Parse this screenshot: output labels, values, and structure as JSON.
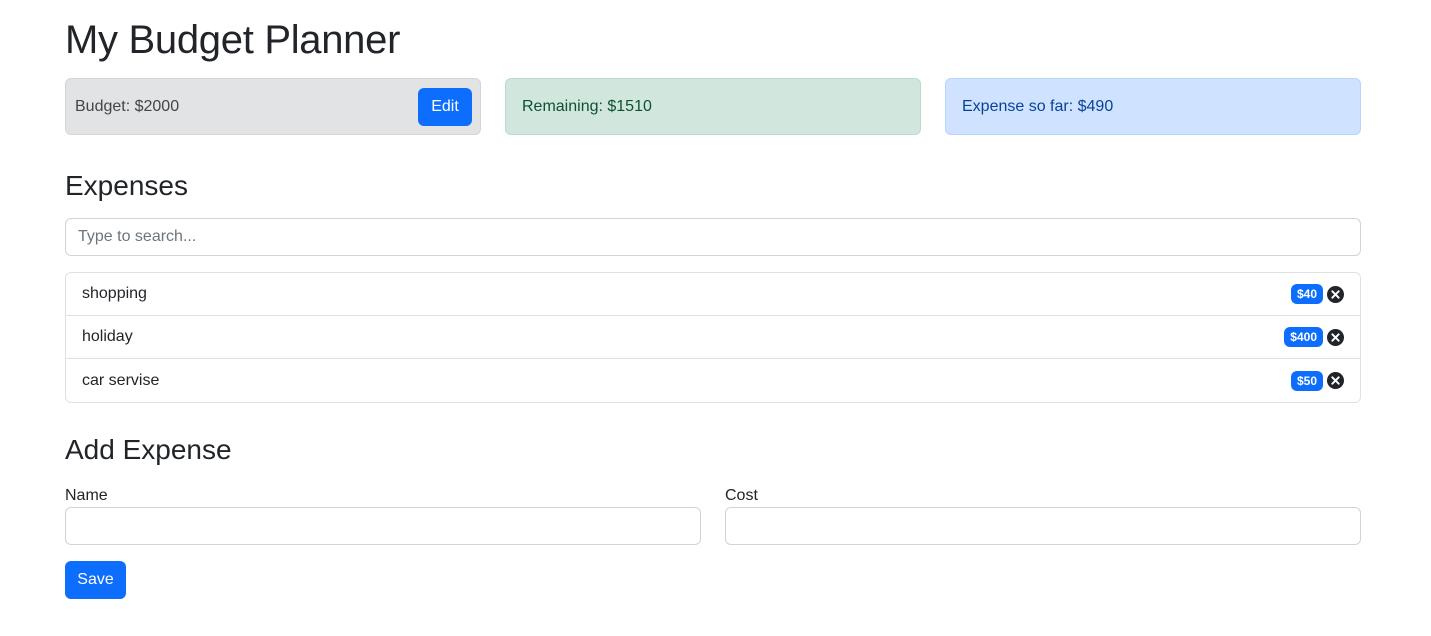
{
  "title": "My Budget Planner",
  "summary": {
    "budget_text": "Budget: $2000",
    "edit_label": "Edit",
    "remaining_text": "Remaining: $1510",
    "spent_text": "Expense so far: $490"
  },
  "expenses": {
    "heading": "Expenses",
    "search_placeholder": "Type to search...",
    "items": [
      {
        "name": "shopping",
        "cost": "$40"
      },
      {
        "name": "holiday",
        "cost": "$400"
      },
      {
        "name": "car servise",
        "cost": "$50"
      }
    ]
  },
  "add_expense": {
    "heading": "Add Expense",
    "name_label": "Name",
    "name_value": "",
    "cost_label": "Cost",
    "cost_value": "",
    "save_label": "Save"
  },
  "colors": {
    "primary": "#0d6efd",
    "budget_bg": "#e2e3e5",
    "remaining_bg": "#d1e7dd",
    "spent_bg": "#cfe2ff"
  },
  "icons": {
    "delete": "x-circle-fill-icon"
  }
}
